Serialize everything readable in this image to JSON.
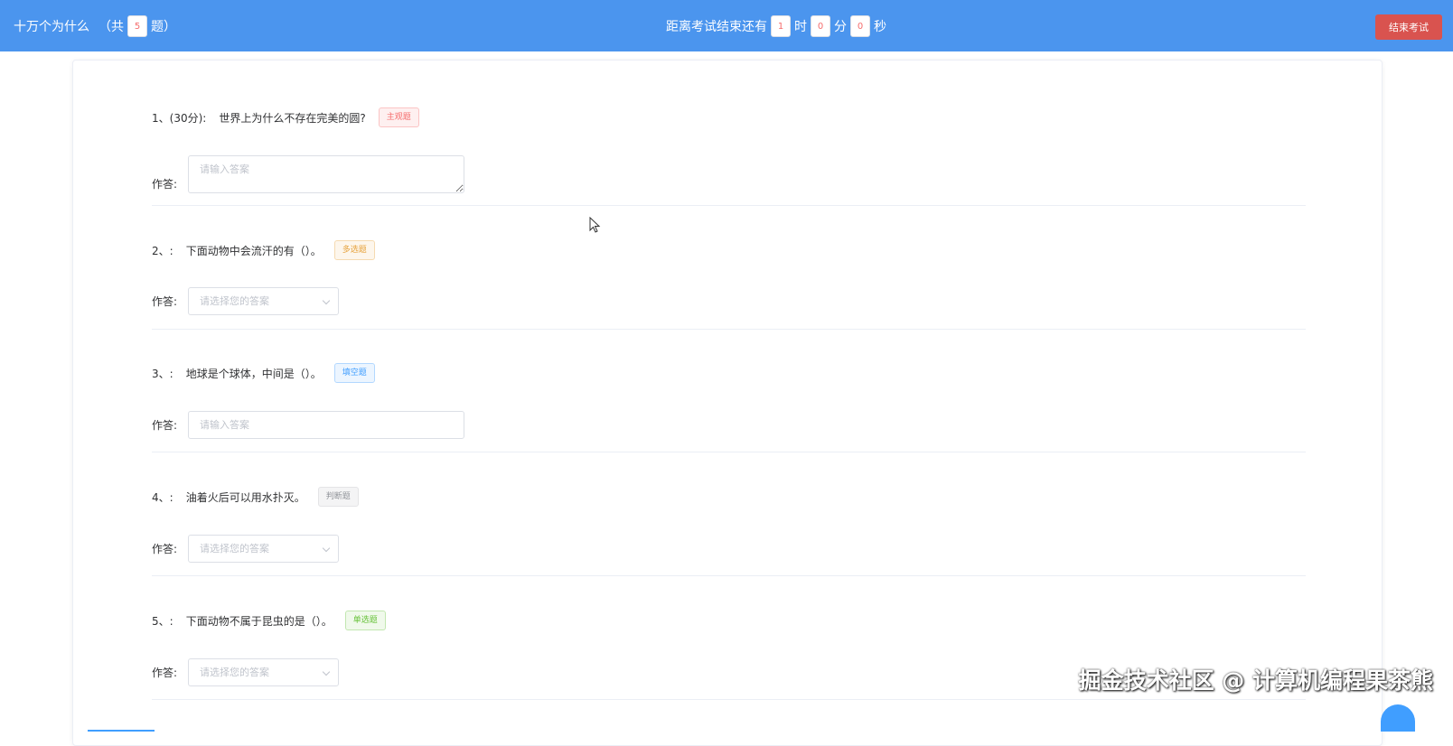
{
  "header": {
    "title": "十万个为什么",
    "count_prefix": "（共",
    "count": "5",
    "count_suffix": "题）",
    "timer_prefix": "距离考试结束还有",
    "hours": "1",
    "hours_unit": "时",
    "minutes": "0",
    "minutes_unit": "分",
    "seconds": "0",
    "seconds_unit": "秒",
    "end_button": "结束考试"
  },
  "answer_label": "作答:",
  "questions": [
    {
      "num": "1、(30分):",
      "title": "世界上为什么不存在完美的圆?",
      "tag": "主观题",
      "placeholder": "请输入答案"
    },
    {
      "num": "2、:",
      "title": "下面动物中会流汗的有（）。",
      "tag": "多选题",
      "placeholder": "请选择您的答案"
    },
    {
      "num": "3、:",
      "title": "地球是个球体，中间是（）。",
      "tag": "填空题",
      "placeholder": "请输入答案"
    },
    {
      "num": "4、:",
      "title": "油着火后可以用水扑灭。",
      "tag": "判断题",
      "placeholder": "请选择您的答案"
    },
    {
      "num": "5、:",
      "title": "下面动物不属于昆虫的是（）。",
      "tag": "单选题",
      "placeholder": "请选择您的答案"
    }
  ],
  "watermark": "掘金技术社区 @ 计算机编程果茶熊",
  "colors": {
    "header_bg": "#4b95ee",
    "end_button_bg": "#d9534f"
  }
}
